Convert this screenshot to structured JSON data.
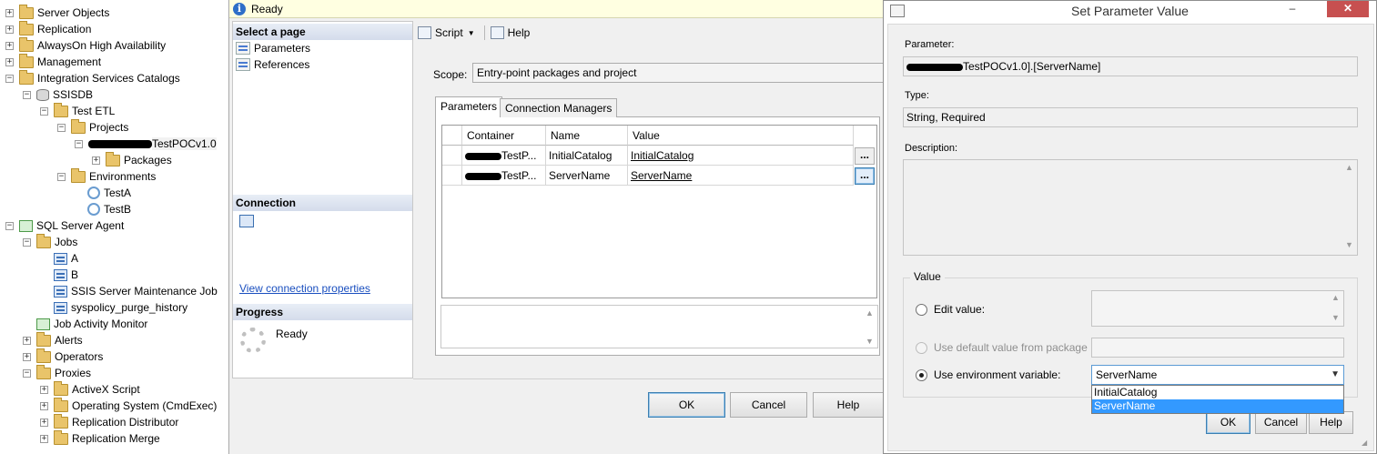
{
  "tree": {
    "items": [
      {
        "label": "Server Objects",
        "expander": "+",
        "icon": "folder"
      },
      {
        "label": "Replication",
        "expander": "+",
        "icon": "folder"
      },
      {
        "label": "AlwaysOn High Availability",
        "expander": "+",
        "icon": "folder"
      },
      {
        "label": "Management",
        "expander": "+",
        "icon": "folder"
      },
      {
        "label": "Integration Services Catalogs",
        "expander": "−",
        "icon": "folder"
      },
      {
        "label": "SSISDB",
        "expander": "−",
        "icon": "database"
      },
      {
        "label": "Test ETL",
        "expander": "−",
        "icon": "folder"
      },
      {
        "label": "Projects",
        "expander": "−",
        "icon": "folder"
      },
      {
        "label": "TestPOCv1.0",
        "expander": "−",
        "icon": "project"
      },
      {
        "label": "Packages",
        "expander": "+",
        "icon": "folder"
      },
      {
        "label": "Environments",
        "expander": "−",
        "icon": "folder"
      },
      {
        "label": "TestA",
        "expander": "",
        "icon": "environment"
      },
      {
        "label": "TestB",
        "expander": "",
        "icon": "environment"
      },
      {
        "label": "SQL Server Agent",
        "expander": "−",
        "icon": "agent"
      },
      {
        "label": "Jobs",
        "expander": "−",
        "icon": "folder"
      },
      {
        "label": "A",
        "expander": "",
        "icon": "job"
      },
      {
        "label": "B",
        "expander": "",
        "icon": "job"
      },
      {
        "label": "SSIS Server Maintenance Job",
        "expander": "",
        "icon": "job"
      },
      {
        "label": "syspolicy_purge_history",
        "expander": "",
        "icon": "job"
      },
      {
        "label": "Job Activity Monitor",
        "expander": "",
        "icon": "monitor"
      },
      {
        "label": "Alerts",
        "expander": "+",
        "icon": "folder"
      },
      {
        "label": "Operators",
        "expander": "+",
        "icon": "folder"
      },
      {
        "label": "Proxies",
        "expander": "−",
        "icon": "folder"
      },
      {
        "label": "ActiveX Script",
        "expander": "+",
        "icon": "folder"
      },
      {
        "label": "Operating System (CmdExec)",
        "expander": "+",
        "icon": "folder"
      },
      {
        "label": "Replication Distributor",
        "expander": "+",
        "icon": "folder"
      },
      {
        "label": "Replication Merge",
        "expander": "+",
        "icon": "folder"
      }
    ]
  },
  "dialog": {
    "status": "Ready",
    "select_page_header": "Select a page",
    "pages": [
      "Parameters",
      "References"
    ],
    "connection_header": "Connection",
    "view_connection_link": "View connection properties",
    "progress_header": "Progress",
    "progress_status": "Ready",
    "toolbar": {
      "script_label": "Script",
      "help_label": "Help"
    },
    "scope_label": "Scope:",
    "scope_value": "Entry-point packages and project",
    "tabs": [
      "Parameters",
      "Connection Managers"
    ],
    "grid": {
      "headers": [
        "Container",
        "Name",
        "Value"
      ],
      "rows": [
        {
          "container": "TestP...",
          "name": "InitialCatalog",
          "value": "InitialCatalog"
        },
        {
          "container": "TestP...",
          "name": "ServerName",
          "value": "ServerName"
        }
      ],
      "ellipsis": "..."
    },
    "buttons": {
      "ok": "OK",
      "cancel": "Cancel",
      "help": "Help"
    }
  },
  "set_param": {
    "title": "Set Parameter Value",
    "parameter_label": "Parameter:",
    "parameter_value": "TestPOCv1.0].[ServerName]",
    "type_label": "Type:",
    "type_value": "String, Required",
    "description_label": "Description:",
    "value_group_label": "Value",
    "edit_value_label": "Edit value:",
    "default_value_label": "Use default value from package",
    "env_var_label": "Use environment variable:",
    "env_var_selected": "ServerName",
    "env_options": [
      "InitialCatalog",
      "ServerName"
    ],
    "buttons": {
      "ok": "OK",
      "cancel": "Cancel",
      "help": "Help"
    },
    "close_glyph": "✕",
    "minimize_glyph": "–"
  }
}
